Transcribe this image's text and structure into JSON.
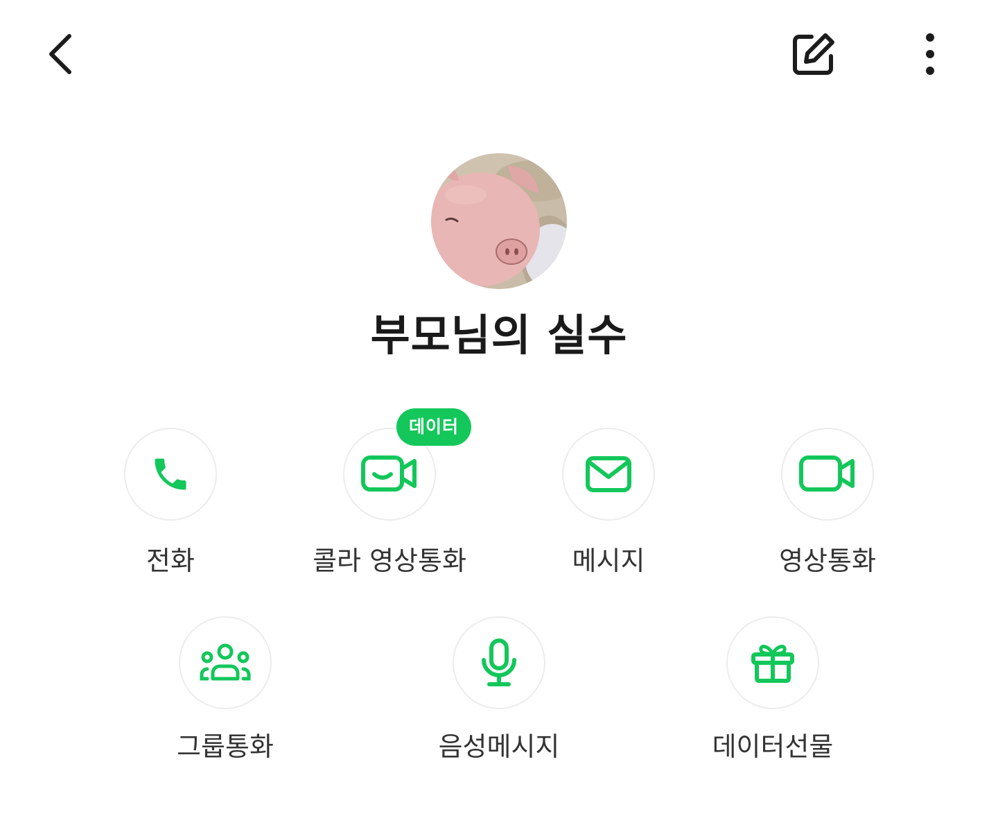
{
  "header": {
    "back_icon": "chevron-left-icon",
    "edit_icon": "edit-square-icon",
    "more_icon": "more-vertical-icon"
  },
  "profile": {
    "avatar_icon": "pig-cartoon-avatar",
    "name": "부모님의 실수"
  },
  "accent_color": "#13c75a",
  "actions": {
    "row1": [
      {
        "label": "전화",
        "icon": "phone-icon"
      },
      {
        "label": "콜라 영상통화",
        "icon": "smile-video-icon",
        "badge": "데이터"
      },
      {
        "label": "메시지",
        "icon": "mail-icon"
      },
      {
        "label": "영상통화",
        "icon": "video-camera-icon"
      }
    ],
    "row2": [
      {
        "label": "그룹통화",
        "icon": "group-icon"
      },
      {
        "label": "음성메시지",
        "icon": "microphone-icon"
      },
      {
        "label": "데이터선물",
        "icon": "gift-icon"
      }
    ]
  }
}
